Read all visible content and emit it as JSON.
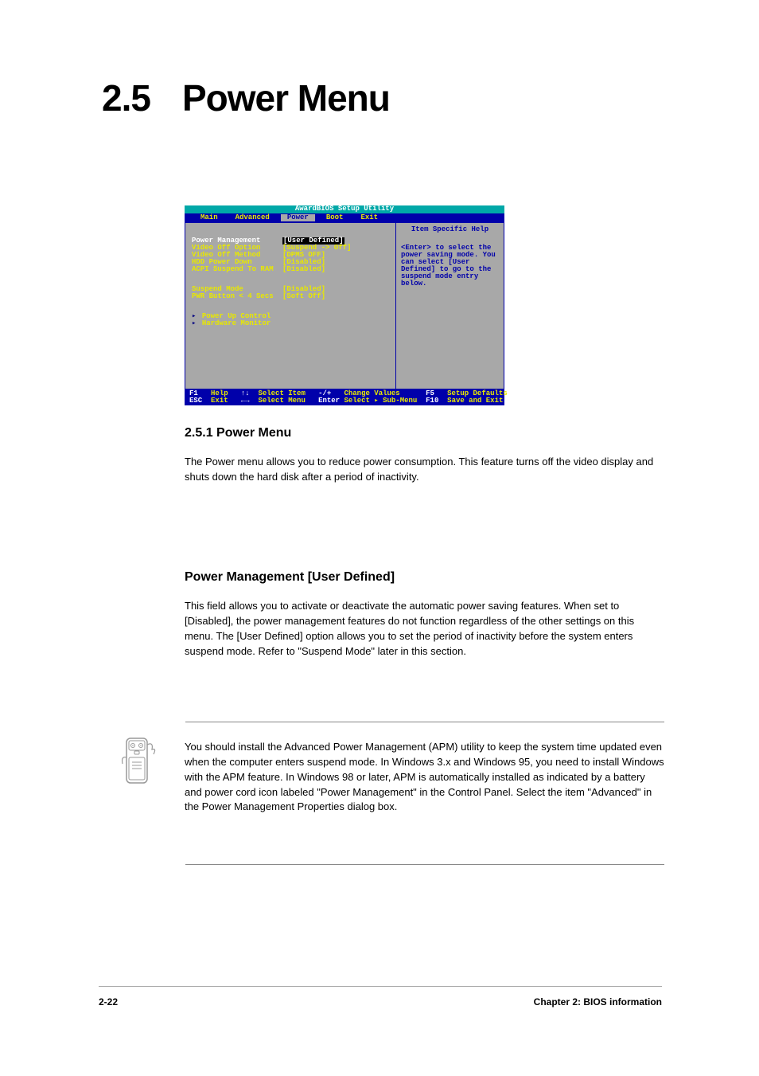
{
  "heading": {
    "number": "2.5",
    "title": "Power Menu"
  },
  "acpi": {
    "title": "2.5.1 Power Menu",
    "text": "The Power menu allows you to reduce power consumption. This feature turns off the video display and shuts down the hard disk after a period of inactivity."
  },
  "pm": {
    "title": "Power Management [User Defined]",
    "text": "This field allows you to activate or deactivate the automatic power saving features. When set to [Disabled], the power management features do not function regardless of the other settings on this menu. The [User Defined] option allows you to set the period of inactivity before the system enters suspend mode. Refer to \"Suspend Mode\" later in this section."
  },
  "note": {
    "text": "You should install the Advanced Power Management (APM) utility to keep the system time updated even when the computer enters suspend mode. In Windows 3.x and Windows 95, you need to install Windows with the APM feature. In Windows 98 or later, APM is automatically installed as indicated by a battery and power cord icon labeled \"Power Management\" in the Control Panel. Select the item \"Advanced\" in the Power Management Properties dialog box."
  },
  "bios": {
    "title_bar": "AwardBIOS Setup Utility",
    "tabs": [
      "Main",
      "Advanced",
      "Power",
      "Boot",
      "Exit"
    ],
    "active_tab_index": 2,
    "help_panel": {
      "title": "Item Specific Help",
      "text": "<Enter> to select the power saving mode. You can select [User Defined] to go to the suspend mode entry below."
    },
    "rows": [
      {
        "label": "Power Management",
        "value": "[User Defined]",
        "selected": true
      },
      {
        "label": "Video Off Option",
        "value": "[Suspend -> Off]"
      },
      {
        "label": "Video Off Method",
        "value": "[DPMS OFF]"
      },
      {
        "label": "HDD Power Down",
        "value": "[Disabled]"
      },
      {
        "label": "ACPI Suspend To RAM",
        "value": "[Disabled]"
      }
    ],
    "rows2": [
      {
        "label": "Suspend Mode",
        "value": "[Disabled]"
      },
      {
        "label": "PWR Button < 4 Secs",
        "value": "[Soft Off]"
      }
    ],
    "submenus": [
      "Power Up Control",
      "Hardware Monitor"
    ],
    "footer": {
      "l1_k1": "F1",
      "l1_t1": "Help",
      "l1_k2": "↑↓",
      "l1_t2": "Select Item",
      "l1_k3": "-/+",
      "l1_t3": "Change Values",
      "l1_k4": "F5",
      "l1_t4": "Setup Defaults",
      "l2_k1": "ESC",
      "l2_t1": "Exit",
      "l2_k2": "←→",
      "l2_t2": "Select Menu",
      "l2_k3": "Enter",
      "l2_t3": "Select ▸ Sub-Menu",
      "l2_k4": "F10",
      "l2_t4": "Save and Exit"
    }
  },
  "footer": {
    "pagenum": "2-22",
    "chapter": "Chapter 2: BIOS information"
  }
}
